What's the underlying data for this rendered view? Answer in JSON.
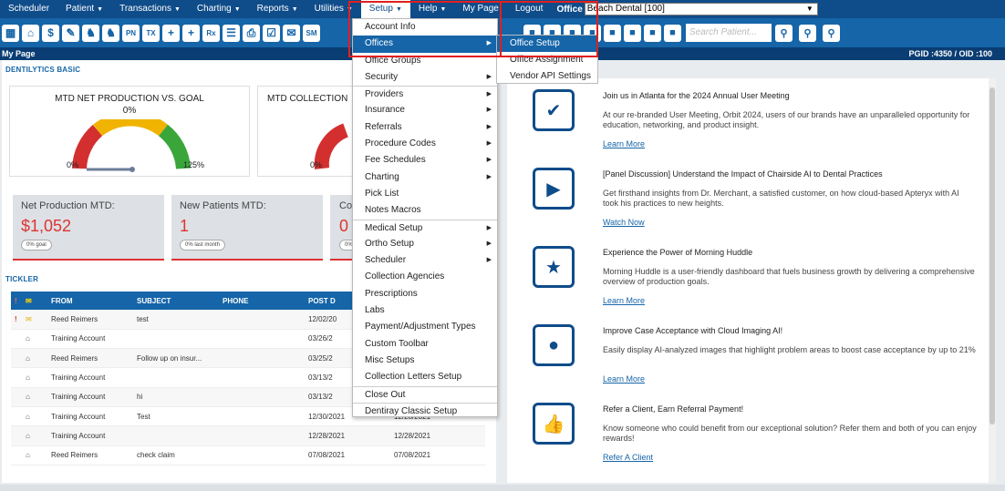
{
  "menubar": {
    "items": [
      {
        "label": "Scheduler",
        "caret": false
      },
      {
        "label": "Patient",
        "caret": true
      },
      {
        "label": "Transactions",
        "caret": true
      },
      {
        "label": "Charting",
        "caret": true
      },
      {
        "label": "Reports",
        "caret": true
      },
      {
        "label": "Utilities",
        "caret": true
      },
      {
        "label": "Setup",
        "caret": true
      },
      {
        "label": "Help",
        "caret": true
      },
      {
        "label": "My Page",
        "caret": false
      },
      {
        "label": "Logout",
        "caret": false
      }
    ],
    "office_label": "Office",
    "office_value": "Beach Dental [100]"
  },
  "toolbar": {
    "icons": [
      "calendar-icon",
      "home-icon",
      "dollar-icon",
      "pencil-icon",
      "tooth-icon",
      "tooth-icon",
      "pn-icon",
      "tx-icon",
      "person-add-icon",
      "person-add-icon",
      "rx-icon",
      "list-icon",
      "printer-icon",
      "check-list-icon",
      "chat-icon",
      "sm-icon"
    ],
    "search_placeholder": "Search Patient..."
  },
  "pagebar": {
    "title": "My Page",
    "ids": "PGID :4350 / OID :100"
  },
  "left": {
    "section_title": "DENTILYTICS BASIC",
    "gauges": [
      {
        "title": "MTD NET PRODUCTION VS. GOAL",
        "pct": "0%",
        "left_label": "0%",
        "right_label": "125%"
      },
      {
        "title": "MTD COLLECTION",
        "pct": "",
        "left_label": "0%",
        "right_label": ""
      }
    ],
    "stats": [
      {
        "label": "Net Production MTD:",
        "value": "$1,052",
        "pill": "0% goal"
      },
      {
        "label": "New Patients MTD:",
        "value": "1",
        "pill": "0% last month"
      },
      {
        "label": "Co",
        "value": "0",
        "pill": "0%"
      }
    ],
    "tickler_title": "TICKLER",
    "tickler_headers": [
      "",
      "",
      "FROM",
      "SUBJECT",
      "PHONE",
      "POST D",
      ""
    ],
    "tickler_rows": [
      {
        "flag": "!",
        "from": "Reed Reimers",
        "subject": "test",
        "phone": "",
        "post": "12/02/20",
        "due": ""
      },
      {
        "flag": "",
        "from": "Training Account",
        "subject": "",
        "phone": "",
        "post": "03/26/2",
        "due": ""
      },
      {
        "flag": "",
        "from": "Reed Reimers",
        "subject": "Follow up on insur...",
        "phone": "",
        "post": "03/25/2",
        "due": ""
      },
      {
        "flag": "",
        "from": "Training Account",
        "subject": "",
        "phone": "",
        "post": "03/13/2",
        "due": ""
      },
      {
        "flag": "",
        "from": "Training Account",
        "subject": "hi",
        "phone": "",
        "post": "03/13/2",
        "due": ""
      },
      {
        "flag": "",
        "from": "Training Account",
        "subject": "Test",
        "phone": "",
        "post": "12/30/2021",
        "due": "12/28/2021"
      },
      {
        "flag": "",
        "from": "Training Account",
        "subject": "",
        "phone": "",
        "post": "12/28/2021",
        "due": "12/28/2021"
      },
      {
        "flag": "",
        "from": "Reed Reimers",
        "subject": "check claim",
        "phone": "",
        "post": "07/08/2021",
        "due": "07/08/2021"
      }
    ]
  },
  "news": [
    {
      "icon": "calendar-check-icon",
      "glyph": "✔",
      "title": "Join us in Atlanta for the 2024 Annual User Meeting",
      "body": "At our re-branded User Meeting, Orbit 2024, users of our brands have an unparalleled opportunity for education, networking, and product insight.",
      "link": "Learn More"
    },
    {
      "icon": "video-play-icon",
      "glyph": "▶",
      "title": "[Panel Discussion] Understand the Impact of Chairside AI to Dental Practices",
      "body": "Get firsthand insights from Dr. Merchant, a satisfied customer, on how cloud-based Apteryx with AI took his practices to new heights.",
      "link": "Watch Now"
    },
    {
      "icon": "monitor-star-icon",
      "glyph": "★",
      "title": "Experience the Power of Morning Huddle",
      "body": "Morning Huddle is a user-friendly dashboard that fuels business growth by delivering a comprehensive overview of production goals.",
      "link": "Learn More"
    },
    {
      "icon": "people-icon",
      "glyph": "●",
      "title": "Improve Case Acceptance with Cloud Imaging AI!",
      "body": "Easily display AI-analyzed images that highlight problem areas to boost case acceptance by up to 21%",
      "link": "Learn More"
    },
    {
      "icon": "thumbs-up-icon",
      "glyph": "👍",
      "title": "Refer a Client, Earn Referral Payment!",
      "body": "Know someone who could benefit from our exceptional solution? Refer them and both of you can enjoy rewards!",
      "link": "Refer A Client"
    }
  ],
  "setup_menu": [
    {
      "label": "Account Info",
      "sub": false,
      "hl": false,
      "sep": false
    },
    {
      "label": "Offices",
      "sub": true,
      "hl": true,
      "sep": false
    },
    {
      "label": "Office Groups",
      "sub": false,
      "hl": false,
      "sep": false
    },
    {
      "label": "Security",
      "sub": true,
      "hl": false,
      "sep": false
    },
    {
      "label": "Providers",
      "sub": true,
      "hl": false,
      "sep": true
    },
    {
      "label": "Insurance",
      "sub": true,
      "hl": false,
      "sep": false
    },
    {
      "label": "Referrals",
      "sub": true,
      "hl": false,
      "sep": false
    },
    {
      "label": "Procedure Codes",
      "sub": true,
      "hl": false,
      "sep": false
    },
    {
      "label": "Fee Schedules",
      "sub": true,
      "hl": false,
      "sep": false
    },
    {
      "label": "Charting",
      "sub": true,
      "hl": false,
      "sep": false
    },
    {
      "label": "Pick List",
      "sub": false,
      "hl": false,
      "sep": false
    },
    {
      "label": "Notes Macros",
      "sub": false,
      "hl": false,
      "sep": false
    },
    {
      "label": "Medical Setup",
      "sub": true,
      "hl": false,
      "sep": true
    },
    {
      "label": "Ortho Setup",
      "sub": true,
      "hl": false,
      "sep": false
    },
    {
      "label": "Scheduler",
      "sub": true,
      "hl": false,
      "sep": false
    },
    {
      "label": "Collection Agencies",
      "sub": false,
      "hl": false,
      "sep": false
    },
    {
      "label": "Prescriptions",
      "sub": false,
      "hl": false,
      "sep": false
    },
    {
      "label": "Labs",
      "sub": false,
      "hl": false,
      "sep": false
    },
    {
      "label": "Payment/Adjustment Types",
      "sub": false,
      "hl": false,
      "sep": false
    },
    {
      "label": "Custom Toolbar",
      "sub": false,
      "hl": false,
      "sep": false
    },
    {
      "label": "Misc Setups",
      "sub": false,
      "hl": false,
      "sep": false
    },
    {
      "label": "Collection Letters Setup",
      "sub": false,
      "hl": false,
      "sep": false
    },
    {
      "label": "Close Out",
      "sub": false,
      "hl": false,
      "sep": true
    },
    {
      "label": "Dentiray Classic Setup",
      "sub": false,
      "hl": false,
      "sep": true
    }
  ],
  "offices_submenu": [
    "Office Setup",
    "Office Assignment",
    "Vendor API Settings"
  ],
  "colors": {
    "accent": "#1565a8",
    "danger": "#d33333",
    "highlight_box": "#e02020"
  }
}
